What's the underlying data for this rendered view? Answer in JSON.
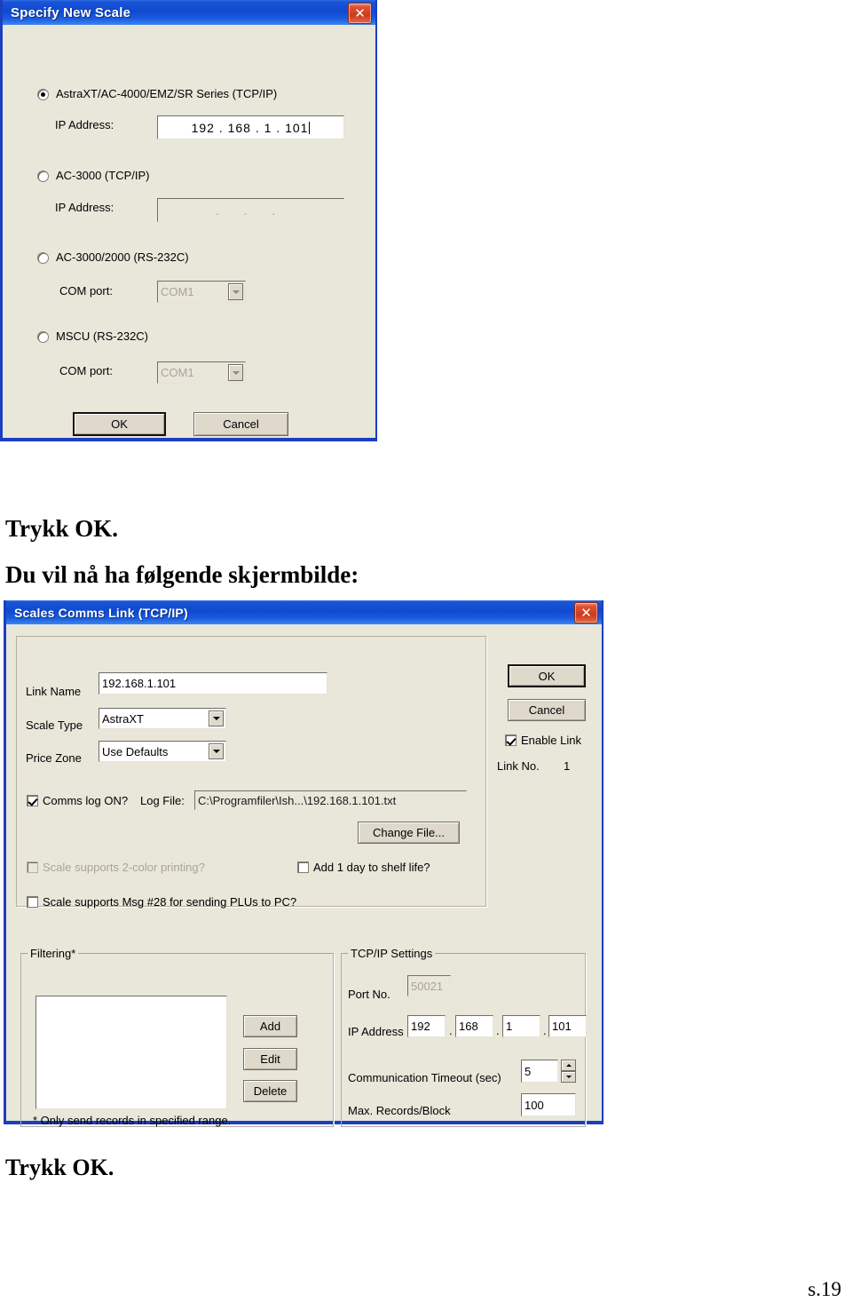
{
  "document": {
    "instruction_1": "Trykk OK.",
    "instruction_2": "Du vil nå ha følgende skjermbilde:",
    "instruction_3": "Trykk OK.",
    "page_number": "s.19"
  },
  "colors": {
    "titlebar_blue": "#0f49d0",
    "dialog_face": "#e9e6da",
    "close_red": "#cc3a1c",
    "border_blue": "#1c3fbf",
    "field_white": "#ffffff",
    "disabled_text": "#a9a498"
  },
  "dialog_specify_new_scale": {
    "title": "Specify New Scale",
    "close_icon": "close-icon",
    "options": [
      {
        "id": "astraxt",
        "label": "AstraXT/AC-4000/EMZ/SR Series   (TCP/IP)",
        "selected": true,
        "field_label": "IP Address:",
        "field_kind": "ip",
        "field_value": "192 . 168 .  1  . 101",
        "field_enabled": true
      },
      {
        "id": "ac3000-tcpip",
        "label": "AC-3000  (TCP/IP)",
        "selected": false,
        "field_label": "IP Address:",
        "field_kind": "ip",
        "field_value": ".        .        .",
        "field_enabled": false
      },
      {
        "id": "ac3000-2000-rs232c",
        "label": "AC-3000/2000  (RS-232C)",
        "selected": false,
        "field_label": "COM port:",
        "field_kind": "combo",
        "field_value": "COM1",
        "field_enabled": false
      },
      {
        "id": "mscu-rs232c",
        "label": "MSCU  (RS-232C)",
        "selected": false,
        "field_label": "COM port:",
        "field_kind": "combo",
        "field_value": "COM1",
        "field_enabled": false
      }
    ],
    "buttons": {
      "ok": "OK",
      "cancel": "Cancel"
    }
  },
  "dialog_scales_comms_link": {
    "title": "Scales Comms Link (TCP/IP)",
    "close_icon": "close-icon",
    "fields": {
      "link_name_label": "Link Name",
      "link_name_value": "192.168.1.101",
      "scale_type_label": "Scale Type",
      "scale_type_value": "AstraXT",
      "price_zone_label": "Price Zone",
      "price_zone_value": "Use Defaults"
    },
    "right_panel": {
      "ok": "OK",
      "cancel": "Cancel",
      "enable_link_label": "Enable Link",
      "enable_link_checked": true,
      "link_no_label": "Link No.",
      "link_no_value": "1"
    },
    "log": {
      "comms_log_label": "Comms log ON?",
      "comms_log_checked": true,
      "log_file_label": "Log File:",
      "log_file_value": "C:\\Programfiler\\Ish...\\192.168.1.101.txt",
      "change_file_button": "Change File..."
    },
    "checkboxes": {
      "two_color_label": "Scale supports 2-color printing?",
      "two_color_checked": false,
      "two_color_enabled": false,
      "shelf_life_label": "Add 1 day to shelf life?",
      "shelf_life_checked": false,
      "msg28_label": "Scale supports Msg #28 for sending PLUs to PC?",
      "msg28_checked": false
    },
    "filtering": {
      "group_title": "Filtering*",
      "list_items": [],
      "add_button": "Add",
      "edit_button": "Edit",
      "delete_button": "Delete",
      "footnote": "* Only send records in specified range."
    },
    "tcpip": {
      "group_title": "TCP/IP Settings",
      "port_label": "Port No.",
      "port_value": "50021",
      "port_enabled": false,
      "ip_label": "IP Address",
      "ip_octets": [
        "192",
        "168",
        "1",
        "101"
      ],
      "timeout_label": "Communication Timeout (sec)",
      "timeout_value": "5",
      "max_records_label": "Max. Records/Block",
      "max_records_value": "100"
    }
  }
}
